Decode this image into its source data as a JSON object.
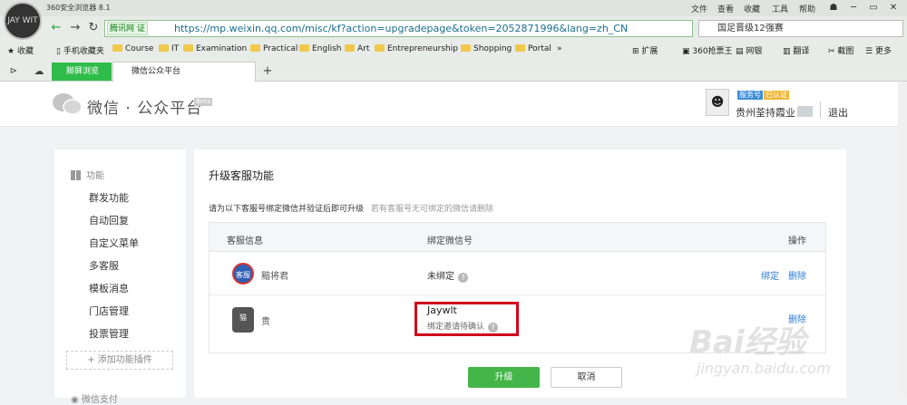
{
  "browser": {
    "app_name": "360安全浏览器 8.1",
    "logo_text": "JAY WIT",
    "menu": [
      "文件",
      "查看",
      "收藏",
      "工具",
      "帮助"
    ],
    "url_badge": "腾讯网 证",
    "url": "https://mp.weixin.qq.com/misc/kf?action=upgradepage&token=2052871996&lang=zh_CN",
    "search_text": "国足晋级12强赛",
    "bookmarks": [
      "收藏",
      "手机收藏夹",
      "Course",
      "IT",
      "Examination",
      "Practical",
      "English",
      "Art",
      "Entrepreneurship",
      "Shopping",
      "Portal"
    ],
    "bookmark_more": "»",
    "tools": [
      "扩展",
      "360抢票王",
      "网银",
      "翻译",
      "截图",
      "更多"
    ],
    "tabs": [
      {
        "label": "脚屏浏览"
      },
      {
        "label": "微信公众平台"
      }
    ],
    "new_tab": "+"
  },
  "header": {
    "brand": "微信 · 公众平台",
    "beta": "Beta",
    "tag_service": "服务号",
    "tag_verified": "已认证",
    "username": "贵州荃持霞业",
    "logout": "退出"
  },
  "sidebar": {
    "section": "功能",
    "items": [
      "群发功能",
      "自动回复",
      "自定义菜单",
      "多客服",
      "模板消息",
      "门店管理",
      "投票管理"
    ],
    "add_plugin": "+ 添加功能插件",
    "section2": "微信支付"
  },
  "main": {
    "title": "升级客服功能",
    "intro": "请为以下客服号绑定微信并验证后即可升级",
    "intro_sub": "若有客服号无可绑定的微信请删除",
    "columns": [
      "客服信息",
      "绑定微信号",
      "操作"
    ],
    "rows": [
      {
        "avatar": "客服",
        "name": "黯将君",
        "status": "未绑定",
        "actions": [
          "绑定",
          "删除"
        ]
      },
      {
        "avatar": "猫",
        "name": "贵",
        "wechat_id": "Jaywlt",
        "status": "绑定邀请待确认",
        "actions": [
          "删除"
        ]
      }
    ],
    "btn_upgrade": "升级",
    "btn_cancel": "取消"
  },
  "watermark": {
    "main": "Bai经验",
    "sub": "jingyan.baidu.com"
  }
}
